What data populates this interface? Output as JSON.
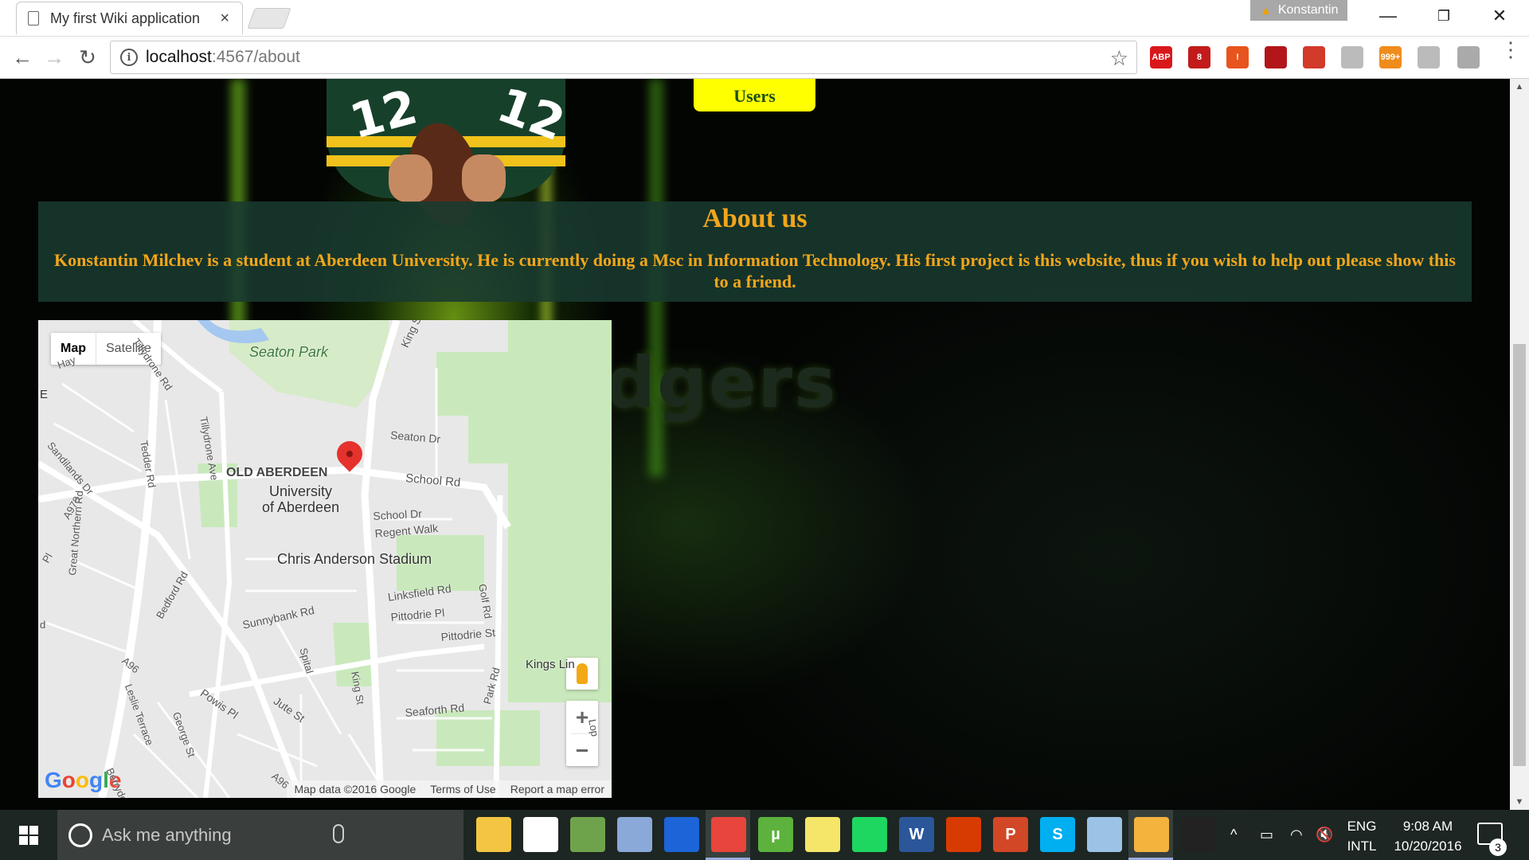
{
  "browser": {
    "tab_title": "My first Wiki application",
    "tab_close": "×",
    "profile_name": "Konstantin",
    "url_host": "localhost",
    "url_path": ":4567/about",
    "extensions": [
      {
        "icon": "adblock-plus-icon",
        "label": "ABP",
        "color": "#d8181b"
      },
      {
        "icon": "ublock-icon",
        "label": "8",
        "color": "#c31b1b"
      },
      {
        "icon": "alert-extension-icon",
        "label": "!",
        "color": "#e8541d"
      },
      {
        "icon": "sofa-extension-icon",
        "label": "",
        "color": "#b3161a"
      },
      {
        "icon": "book-extension-icon",
        "label": "",
        "color": "#d23a2a"
      },
      {
        "icon": "grid-extension-icon",
        "label": "",
        "color": "#bbbbbb"
      },
      {
        "icon": "rss-extension-icon",
        "label": "999+",
        "color": "#f08c1c"
      },
      {
        "icon": "coffee-extension-icon",
        "label": "",
        "color": "#bbbbbb"
      },
      {
        "icon": "pen-extension-icon",
        "label": "",
        "color": "#aaaaaa"
      }
    ]
  },
  "page": {
    "users_button": "Users",
    "about_title": "About us",
    "about_text": "Konstantin Milchev is a student at Aberdeen University. He is currently doing a Msc in Information Technology. His first project is this website, thus if you wish to help out please show this to a friend.",
    "background_logo_text": "dgers"
  },
  "map": {
    "type_map": "Map",
    "type_satellite": "Satellite",
    "zoom_in": "+",
    "zoom_out": "−",
    "google_logo": "Google",
    "footer": {
      "map_data": "Map data ©2016 Google",
      "terms": "Terms of Use",
      "report": "Report a map error"
    },
    "labels": {
      "seaton_park": "Seaton Park",
      "king_st": "King St",
      "tillydrone_rd": "Tillydrone Rd",
      "tillydrone_ave": "Tillydrone Ave",
      "tedder_rd": "Tedder Rd",
      "sandilands_dr": "Sandilands Dr",
      "seaton_dr": "Seaton Dr",
      "old_aberdeen": "OLD ABERDEEN",
      "school_rd": "School Rd",
      "university": "University",
      "of_aberdeen": "of Aberdeen",
      "school_dr": "School Dr",
      "regent_walk": "Regent Walk",
      "a978": "A978",
      "great_northern_rd": "Great Northern Rd",
      "chris_anderson": "Chris Anderson Stadium",
      "golf_rd": "Golf Rd",
      "linksfield_rd": "Linksfield Rd",
      "pittodrie_pl": "Pittodrie Pl",
      "bedford_rd": "Bedford Rd",
      "sunnybank_rd": "Sunnybank Rd",
      "pittodrie_st": "Pittodrie St",
      "a96": "A96",
      "spital": "Spital",
      "king_st_2": "King St",
      "leslie_terrace": "Leslie Terrace",
      "powis_pl": "Powis Pl",
      "kings_links": "Kings Lin",
      "george_st": "George St",
      "jute_st": "Jute St",
      "seaforth_rd": "Seaforth Rd",
      "park_rd": "Park Rd",
      "berryden": "Berryden",
      "a96_2": "A96",
      "hay": "Hay",
      "e": "E",
      "pl": "Pl",
      "d": "d",
      "lop": "Lop"
    }
  },
  "taskbar": {
    "search_placeholder": "Ask me anything",
    "lang_top": "ENG",
    "lang_bottom": "INTL",
    "time": "9:08 AM",
    "date": "10/20/2016",
    "notification_count": "3",
    "apps": [
      {
        "icon": "file-explorer-icon",
        "color": "#f4c542",
        "label": ""
      },
      {
        "icon": "store-icon",
        "color": "#ffffff",
        "label": ""
      },
      {
        "icon": "minecraft-icon",
        "color": "#6fa34b",
        "label": ""
      },
      {
        "icon": "cube-app-icon",
        "color": "#8aa8d8",
        "label": ""
      },
      {
        "icon": "defender-icon",
        "color": "#1c64d8",
        "label": ""
      },
      {
        "icon": "chrome-icon",
        "color": "#e8453c",
        "label": ""
      },
      {
        "icon": "utorrent-icon",
        "color": "#5cb23c",
        "label": "µ"
      },
      {
        "icon": "sticky-notes-icon",
        "color": "#f5e66a",
        "label": ""
      },
      {
        "icon": "spotify-icon",
        "color": "#1ed760",
        "label": ""
      },
      {
        "icon": "word-icon",
        "color": "#2b579a",
        "label": "W"
      },
      {
        "icon": "office-icon",
        "color": "#d83b01",
        "label": ""
      },
      {
        "icon": "powerpoint-icon",
        "color": "#d24726",
        "label": "P"
      },
      {
        "icon": "skype-icon",
        "color": "#00aff0",
        "label": "S"
      },
      {
        "icon": "paint-icon",
        "color": "#9cc3e6",
        "label": ""
      },
      {
        "icon": "weather-icon",
        "color": "#f3b33d",
        "label": ""
      },
      {
        "icon": "terminal-icon",
        "color": "#222222",
        "label": ""
      }
    ]
  }
}
